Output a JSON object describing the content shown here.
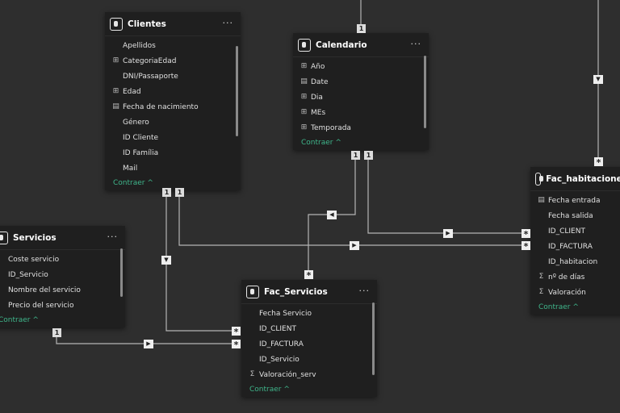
{
  "collapse_label": "Contraer ^",
  "more_label": "···",
  "tables": {
    "clientes": {
      "title": "Clientes",
      "fields": [
        {
          "name": "Apellidos",
          "icon": ""
        },
        {
          "name": "CategoriaEdad",
          "icon": "calculated-column-icon"
        },
        {
          "name": "DNI/Passaporte",
          "icon": ""
        },
        {
          "name": "Edad",
          "icon": "calculated-column-icon"
        },
        {
          "name": "Fecha de nacimiento",
          "icon": "calendar-icon"
        },
        {
          "name": "Género",
          "icon": ""
        },
        {
          "name": "ID Cliente",
          "icon": ""
        },
        {
          "name": "ID Família",
          "icon": ""
        },
        {
          "name": "Mail",
          "icon": ""
        }
      ]
    },
    "calendario": {
      "title": "Calendario",
      "fields": [
        {
          "name": "Año",
          "icon": "calculated-column-icon"
        },
        {
          "name": "Date",
          "icon": "calendar-icon"
        },
        {
          "name": "Dia",
          "icon": "calculated-column-icon"
        },
        {
          "name": "MEs",
          "icon": "calculated-column-icon"
        },
        {
          "name": "Temporada",
          "icon": "calculated-column-icon"
        }
      ]
    },
    "fac_habitaciones": {
      "title": "Fac_habitaciones",
      "fields": [
        {
          "name": "Fecha entrada",
          "icon": "calendar-icon"
        },
        {
          "name": "Fecha salida",
          "icon": ""
        },
        {
          "name": "ID_CLIENT",
          "icon": ""
        },
        {
          "name": "ID_FACTURA",
          "icon": ""
        },
        {
          "name": "ID_habitacion",
          "icon": ""
        },
        {
          "name": "nº de días",
          "icon": "sigma-icon"
        },
        {
          "name": "Valoración",
          "icon": "sigma-icon"
        }
      ]
    },
    "servicios": {
      "title": "Servicios",
      "fields": [
        {
          "name": "Coste servicio",
          "icon": ""
        },
        {
          "name": "ID_Servicio",
          "icon": ""
        },
        {
          "name": "Nombre del servicio",
          "icon": ""
        },
        {
          "name": "Precio del servicio",
          "icon": ""
        }
      ]
    },
    "fac_servicios": {
      "title": "Fac_Servicios",
      "fields": [
        {
          "name": "Fecha Servicio",
          "icon": ""
        },
        {
          "name": "ID_CLIENT",
          "icon": ""
        },
        {
          "name": "ID_FACTURA",
          "icon": ""
        },
        {
          "name": "ID_Servicio",
          "icon": ""
        },
        {
          "name": "Valoración_serv",
          "icon": "sigma-icon"
        }
      ]
    }
  },
  "cardinality": {
    "one": "1",
    "many": "*"
  }
}
